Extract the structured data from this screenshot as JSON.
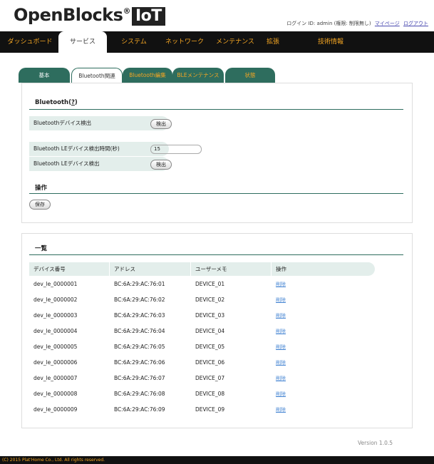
{
  "header": {
    "logo_text": "OpenBlocks",
    "logo_reg": "®",
    "logo_badge": "IoT",
    "login_info": "ログイン ID: admin (権限: 制限無し)",
    "mypage_link": "マイページ",
    "logout_link": "ログアウト"
  },
  "nav": {
    "items": [
      {
        "label": "ダッシュボード"
      },
      {
        "label": "サービス"
      },
      {
        "label": "システム"
      },
      {
        "label": "ネットワーク"
      },
      {
        "label": "メンテナンス"
      },
      {
        "label": "拡張"
      },
      {
        "label": "技術情報"
      }
    ],
    "active": "サービス"
  },
  "subtabs": {
    "items": [
      {
        "label": "基本"
      },
      {
        "label": "Bluetooth関連"
      },
      {
        "label": "Bluetooth編集"
      },
      {
        "label": "BLEメンテナンス"
      },
      {
        "label": "状態"
      }
    ],
    "active": "Bluetooth関連"
  },
  "bluetooth": {
    "title": "Bluetooth",
    "help": "?",
    "detect_label": "Bluetoothデバイス検出",
    "detect_button": "検出",
    "le_time_label": "Bluetooth LEデバイス検出時間(秒)",
    "le_time_value": "15",
    "le_detect_label": "Bluetooth LEデバイス検出",
    "le_detect_button": "検出",
    "ops_title": "操作",
    "save_button": "保存"
  },
  "list": {
    "title": "一覧",
    "columns": [
      "デバイス番号",
      "アドレス",
      "ユーザーメモ",
      "操作"
    ],
    "rows": [
      {
        "id": "dev_le_0000001",
        "addr": "BC:6A:29:AC:76:01",
        "memo": "DEVICE_01",
        "action": "削除"
      },
      {
        "id": "dev_le_0000002",
        "addr": "BC:6A:29:AC:76:02",
        "memo": "DEVICE_02",
        "action": "削除"
      },
      {
        "id": "dev_le_0000003",
        "addr": "BC:6A:29:AC:76:03",
        "memo": "DEVICE_03",
        "action": "削除"
      },
      {
        "id": "dev_le_0000004",
        "addr": "BC:6A:29:AC:76:04",
        "memo": "DEVICE_04",
        "action": "削除"
      },
      {
        "id": "dev_le_0000005",
        "addr": "BC:6A:29:AC:76:05",
        "memo": "DEVICE_05",
        "action": "削除"
      },
      {
        "id": "dev_le_0000006",
        "addr": "BC:6A:29:AC:76:06",
        "memo": "DEVICE_06",
        "action": "削除"
      },
      {
        "id": "dev_le_0000007",
        "addr": "BC:6A:29:AC:76:07",
        "memo": "DEVICE_07",
        "action": "削除"
      },
      {
        "id": "dev_le_0000008",
        "addr": "BC:6A:29:AC:76:08",
        "memo": "DEVICE_08",
        "action": "削除"
      },
      {
        "id": "dev_le_0000009",
        "addr": "BC:6A:29:AC:76:09",
        "memo": "DEVICE_09",
        "action": "削除"
      }
    ]
  },
  "version": "Version 1.0.5",
  "footer": "(C) 2015 Plat'Home Co., Ltd. All rights reserved.",
  "colors": {
    "accent_orange": "#f5a623",
    "tab_green": "#2e6d5e",
    "label_bg": "#e3eeeb",
    "link_blue": "#4a88d4",
    "nav_bg": "#111111"
  }
}
